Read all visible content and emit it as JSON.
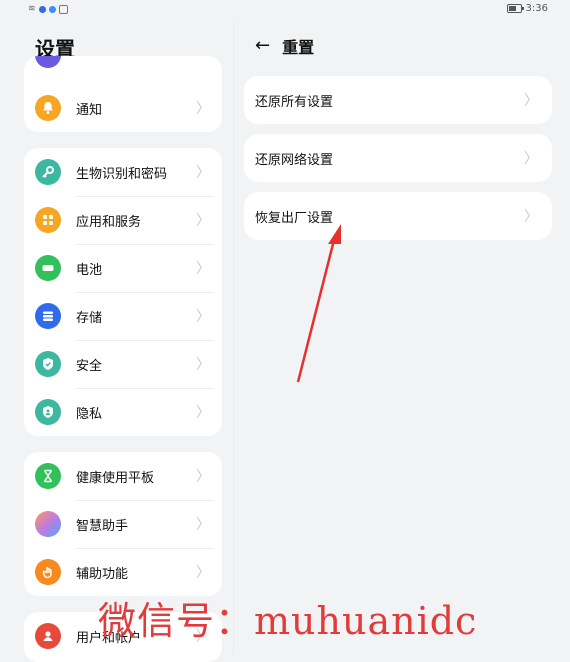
{
  "status": {
    "time": "3:36"
  },
  "left": {
    "title": "设置",
    "groups": [
      {
        "items": [
          {
            "label": "通知",
            "icon": "bell-icon",
            "color": "#f5a623"
          }
        ]
      },
      {
        "items": [
          {
            "label": "生物识别和密码",
            "icon": "key-icon",
            "color": "#3cb8a0"
          },
          {
            "label": "应用和服务",
            "icon": "apps-grid-icon",
            "color": "#f5a623"
          },
          {
            "label": "电池",
            "icon": "battery-icon",
            "color": "#31c05a"
          },
          {
            "label": "存储",
            "icon": "storage-icon",
            "color": "#2f6bea"
          },
          {
            "label": "安全",
            "icon": "shield-check-icon",
            "color": "#3cb8a0"
          },
          {
            "label": "隐私",
            "icon": "privacy-shield-icon",
            "color": "#3cb8a0"
          }
        ]
      },
      {
        "items": [
          {
            "label": "健康使用平板",
            "icon": "hourglass-icon",
            "color": "#31c05a"
          },
          {
            "label": "智慧助手",
            "icon": "assistant-orb-icon",
            "color": "#c07ae0"
          },
          {
            "label": "辅助功能",
            "icon": "hand-icon",
            "color": "#f58a1f"
          }
        ]
      },
      {
        "items": [
          {
            "label": "用户和帐户",
            "icon": "user-icon",
            "color": "#e84a3a"
          }
        ]
      }
    ]
  },
  "right": {
    "title": "重置",
    "items": [
      {
        "label": "还原所有设置"
      },
      {
        "label": "还原网络设置"
      },
      {
        "label": "恢复出厂设置"
      }
    ]
  },
  "annotation": {
    "color": "#e8302a"
  },
  "watermark": "微信号：muhuanidc"
}
